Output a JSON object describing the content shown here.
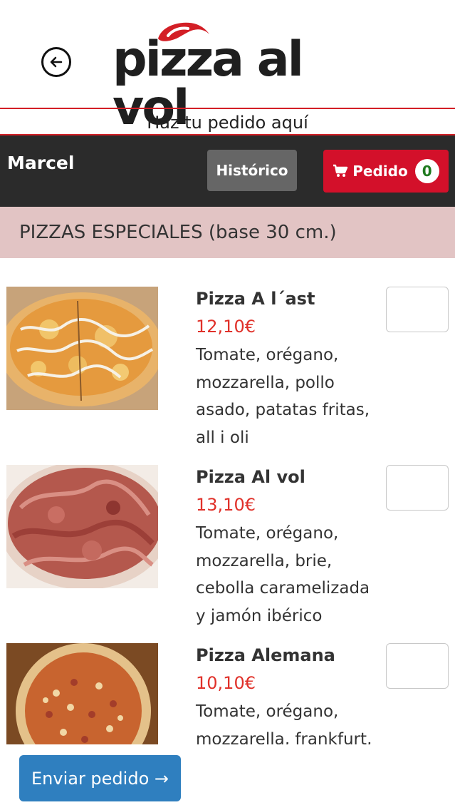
{
  "header": {
    "logo_text": "pizza al vol",
    "tagline": "Haz tu pedido aquí"
  },
  "userbar": {
    "username": "Marcel",
    "historico_label": "Histórico",
    "pedido_label": "Pedido",
    "pedido_count": "0"
  },
  "category": {
    "title": "PIZZAS ESPECIALES (base 30 cm.)"
  },
  "items": [
    {
      "name": "Pizza A l´ast",
      "price": "12,10€",
      "description": "Tomate, orégano, mozzarella, pollo asado, patatas fritas, all i oli"
    },
    {
      "name": "Pizza Al vol",
      "price": "13,10€",
      "description": "Tomate, orégano, mozzarella, brie, cebolla caramelizada y jamón ibérico"
    },
    {
      "name": "Pizza Alemana",
      "price": "10,10€",
      "description": "Tomate, orégano, mozzarella, frankfurt, bacon"
    }
  ],
  "footer": {
    "send_label": "Enviar pedido →"
  },
  "colors": {
    "brand_red": "#d3102a",
    "price_red": "#e0312a",
    "dark_bar": "#2b2b2b",
    "category_bg": "#e2c4c4",
    "send_blue": "#2f7fbf"
  }
}
